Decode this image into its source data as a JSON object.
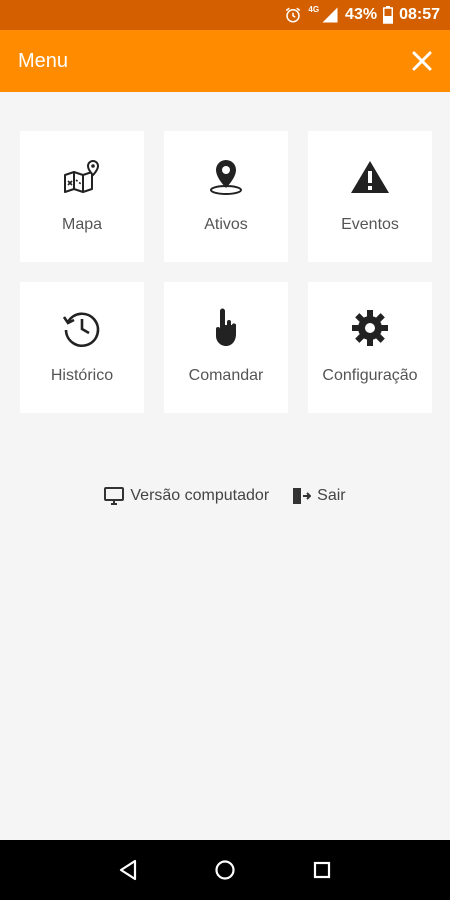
{
  "status_bar": {
    "network": "4G",
    "battery": "43%",
    "time": "08:57",
    "icons": [
      "alarm-icon",
      "signal-icon",
      "battery-icon"
    ]
  },
  "header": {
    "title": "Menu",
    "close_icon": "close-icon",
    "background_color": "#ff8c00"
  },
  "menu": {
    "items": [
      {
        "label": "Mapa",
        "icon": "map-icon"
      },
      {
        "label": "Ativos",
        "icon": "location-pin-icon"
      },
      {
        "label": "Eventos",
        "icon": "warning-icon"
      },
      {
        "label": "Histórico",
        "icon": "history-icon"
      },
      {
        "label": "Comandar",
        "icon": "hand-pointer-icon"
      },
      {
        "label": "Configuração",
        "icon": "gear-icon"
      }
    ]
  },
  "footer_links": {
    "desktop": {
      "label": "Versão computador",
      "icon": "monitor-icon"
    },
    "logout": {
      "label": "Sair",
      "icon": "exit-icon"
    }
  },
  "nav_bar": {
    "icons": [
      "back-icon",
      "home-icon",
      "recents-icon"
    ]
  }
}
